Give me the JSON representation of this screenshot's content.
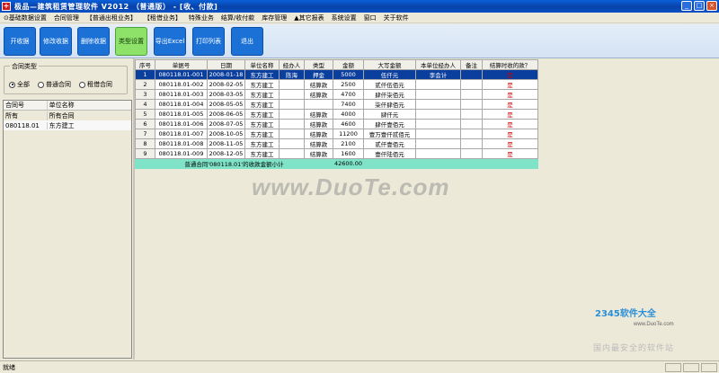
{
  "title": "极品—建筑租赁管理软件 V2012  （普通版） - [收、付款]",
  "window_buttons": [
    "_",
    "□",
    "×"
  ],
  "menu": [
    "⊙基础数据设置",
    "合同管理",
    "【普通出租业务】",
    "【租借业务】",
    "特殊业务",
    "结算/收付款",
    "库存管理",
    "▲其它报表",
    "系统设置",
    "窗口",
    "关于软件"
  ],
  "toolbar": [
    "开收据",
    "修改收据",
    "删除收据",
    "类型设置",
    "导出Excel",
    "打印列表",
    "退出"
  ],
  "contract_type": {
    "title": "合同类型",
    "options": [
      "全部",
      "普通合同",
      "租借合同"
    ],
    "selected": "全部"
  },
  "left_grid": {
    "headers": [
      "合同号",
      "单位名称"
    ],
    "rows": [
      [
        "所有",
        "所有合同"
      ],
      [
        "080118.01",
        "东方建工"
      ]
    ]
  },
  "main_grid": {
    "headers": [
      "序号",
      "单据号",
      "日期",
      "单位名称",
      "经办人",
      "类型",
      "金额",
      "大写金额",
      "本单位经办人",
      "备注",
      "结算时收的款？"
    ],
    "rows": [
      [
        "1",
        "080118.01-001",
        "2008-01-18",
        "东方建工",
        "陈海",
        "押金",
        "5000",
        "伍仟元",
        "李会计",
        "",
        "是"
      ],
      [
        "2",
        "080118.01-002",
        "2008-02-05",
        "东方建工",
        "",
        "结算款",
        "2500",
        "贰仟伍佰元",
        "",
        "",
        "是"
      ],
      [
        "3",
        "080118.01-003",
        "2008-03-05",
        "东方建工",
        "",
        "结算款",
        "4700",
        "肆仟柒佰元",
        "",
        "",
        "是"
      ],
      [
        "4",
        "080118.01-004",
        "2008-05-05",
        "东方建工",
        "",
        "",
        "7400",
        "柒仟肆佰元",
        "",
        "",
        "是"
      ],
      [
        "5",
        "080118.01-005",
        "2008-06-05",
        "东方建工",
        "",
        "结算款",
        "4000",
        "肆仟元",
        "",
        "",
        "是"
      ],
      [
        "6",
        "080118.01-006",
        "2008-07-05",
        "东方建工",
        "",
        "结算款",
        "4600",
        "肆仟壹佰元",
        "",
        "",
        "是"
      ],
      [
        "7",
        "080118.01-007",
        "2008-10-05",
        "东方建工",
        "",
        "结算款",
        "11200",
        "壹万壹仟贰佰元",
        "",
        "",
        "是"
      ],
      [
        "8",
        "080118.01-008",
        "2008-11-05",
        "东方建工",
        "",
        "结算款",
        "2100",
        "贰仟壹佰元",
        "",
        "",
        "是"
      ],
      [
        "9",
        "080118.01-009",
        "2008-12-05",
        "东方建工",
        "",
        "结算款",
        "1600",
        "壹仟陆佰元",
        "",
        "",
        "是"
      ]
    ],
    "summary_label": "普通合同'080118.01'的收款金额小计",
    "summary_total": "42600.00"
  },
  "watermark": "www.DuoTe.com",
  "logo": "2345软件大全",
  "logo_url": "www.DuoTe.com",
  "logo_slogan": "国内最安全的软件站",
  "status": "就绪",
  "colors": {
    "selected_row": "#0b3f9e",
    "summary_row": "#7fe3c8",
    "active_button": "#8ee26a",
    "toolbar_button": "#1b71d6",
    "yes_text": "#d00000"
  }
}
